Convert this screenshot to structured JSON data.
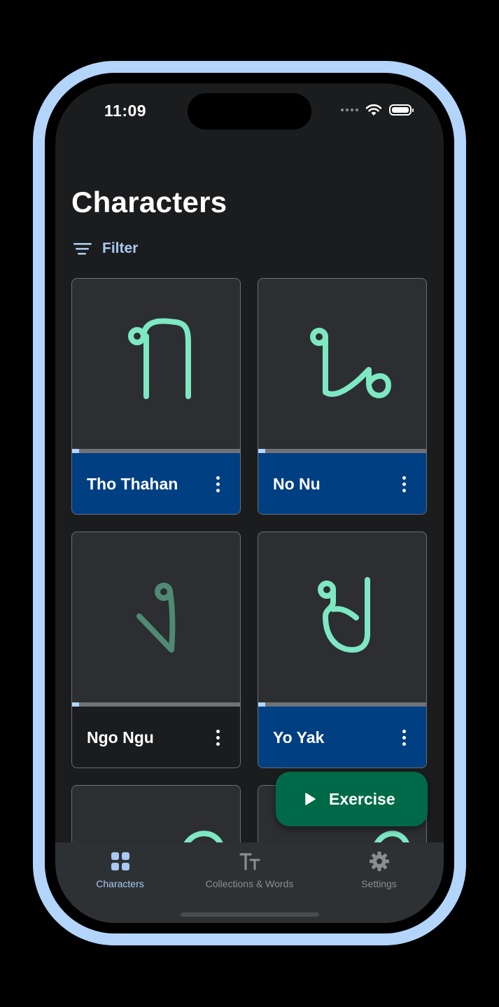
{
  "status_bar": {
    "time": "11:09"
  },
  "header": {
    "title": "Characters",
    "filter_label": "Filter"
  },
  "cards": [
    {
      "name": "Tho Thahan",
      "glyph": "tho-thahan",
      "glyph_color": "#7de8c2",
      "progress": 0.04,
      "selected": true
    },
    {
      "name": "No Nu",
      "glyph": "no-nu",
      "glyph_color": "#7de8c2",
      "progress": 0.04,
      "selected": true
    },
    {
      "name": "Ngo Ngu",
      "glyph": "ngo-ngu",
      "glyph_color": "#4f8a73",
      "progress": 0.04,
      "selected": false
    },
    {
      "name": "Yo Yak",
      "glyph": "yo-yak",
      "glyph_color": "#7de8c2",
      "progress": 0.04,
      "selected": true
    }
  ],
  "fab": {
    "label": "Exercise",
    "icon": "play-icon"
  },
  "tabs": [
    {
      "label": "Characters",
      "icon": "grid-icon",
      "active": true
    },
    {
      "label": "Collections & Words",
      "icon": "text-size-icon",
      "active": false
    },
    {
      "label": "Settings",
      "icon": "gear-icon",
      "active": false
    }
  ],
  "colors": {
    "accent": "#a8c9f3",
    "selected_footer": "#003f82",
    "fab": "#006a48",
    "glyph": "#7de8c2",
    "frame": "#b3d5fb"
  }
}
